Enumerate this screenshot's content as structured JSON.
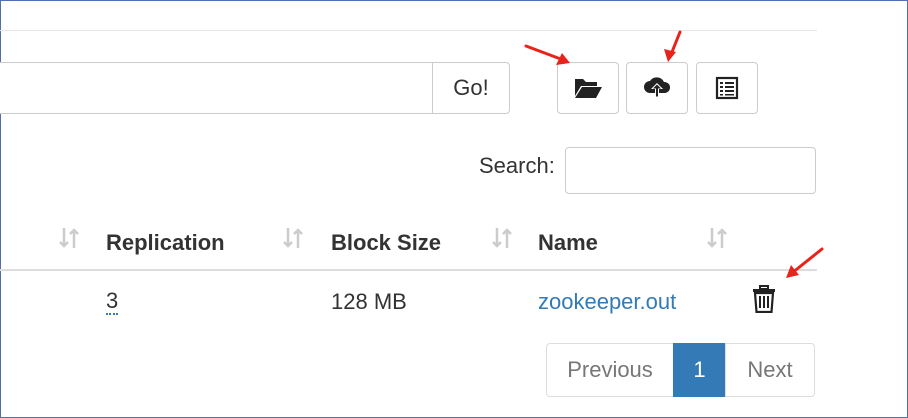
{
  "toolbar": {
    "path_input_value": "",
    "go_label": "Go!",
    "buttons": [
      {
        "icon": "folder-open-icon",
        "action": "create-directory"
      },
      {
        "icon": "cloud-upload-icon",
        "action": "upload"
      },
      {
        "icon": "list-icon",
        "action": "cut-paste"
      }
    ]
  },
  "search": {
    "label": "Search:",
    "value": ""
  },
  "table": {
    "columns": [
      "Replication",
      "Block Size",
      "Name"
    ],
    "rows": [
      {
        "replication": "3",
        "block_size": "128 MB",
        "name": "zookeeper.out",
        "action_icon": "trash-icon"
      }
    ]
  },
  "pagination": {
    "previous": "Previous",
    "current": "1",
    "next": "Next"
  },
  "colors": {
    "accent": "#337ab7",
    "annotation_arrow": "#e8231c",
    "frame": "#4f6fb3"
  }
}
